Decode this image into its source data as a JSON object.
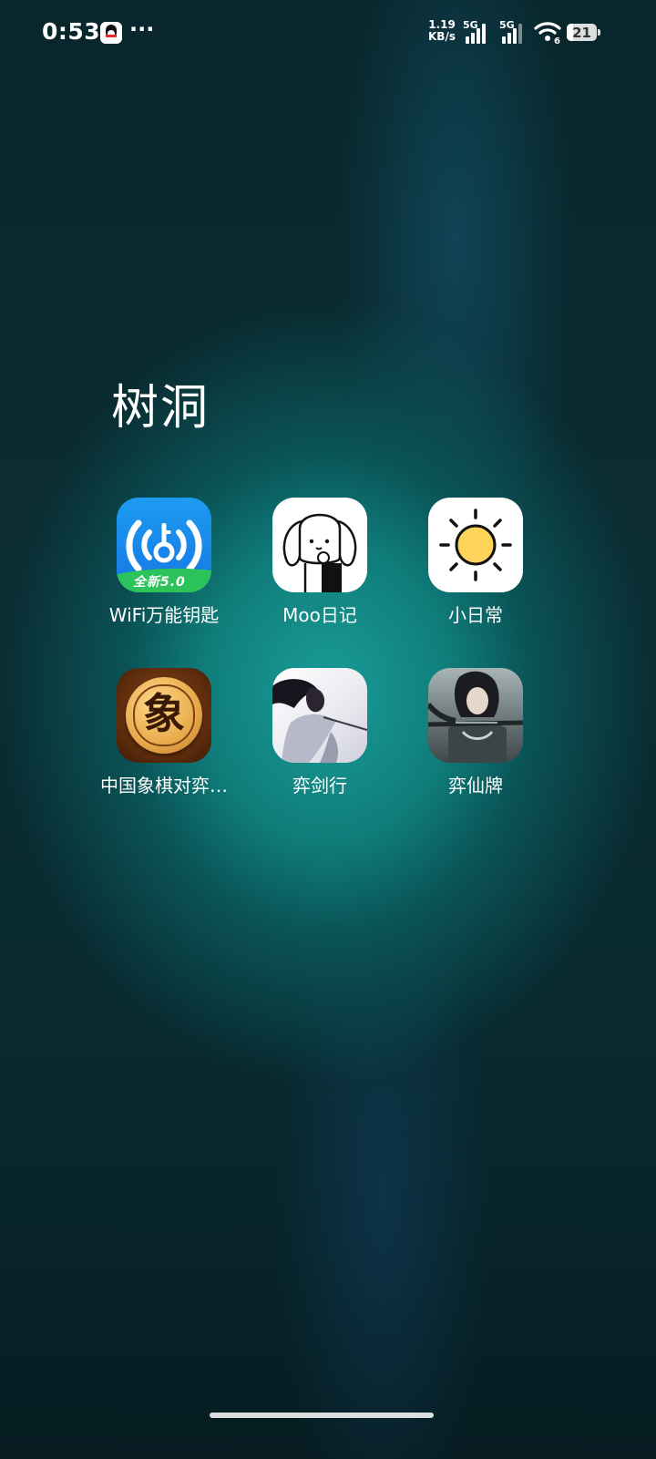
{
  "status_bar": {
    "time": "0:53",
    "dots": "···",
    "speed_value": "1.19",
    "speed_unit": "KB/s",
    "sim1_label": "5G",
    "sim2_label": "5G",
    "wifi_badge": "6",
    "battery": "21"
  },
  "folder": {
    "title": "树洞",
    "apps": [
      {
        "label": "WiFi万能钥匙",
        "icon": "wifi-key-icon",
        "badge": "全新5.0"
      },
      {
        "label": "Moo日记",
        "icon": "moo-diary-icon"
      },
      {
        "label": "小日常",
        "icon": "sun-icon"
      },
      {
        "label": "中国象棋对弈…",
        "icon": "chinese-chess-icon",
        "glyph": "象"
      },
      {
        "label": "弈剑行",
        "icon": "yijianxing-icon"
      },
      {
        "label": "弈仙牌",
        "icon": "yixianpai-icon"
      }
    ]
  }
}
